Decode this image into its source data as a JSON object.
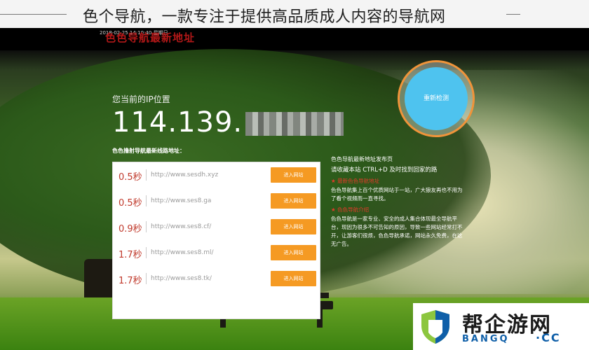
{
  "caption": {
    "text": "色个导航，一款专注于提供高品质成人内容的导航网"
  },
  "header": {
    "date": "2018-02-25 14:10:40 星期日",
    "title": "色色导航最新地址"
  },
  "ip": {
    "label": "您当前的IP位置",
    "value_visible": "114.139."
  },
  "links": {
    "label": "色色撸射导航最新线路地址：",
    "rows": [
      {
        "speed": "0.5秒",
        "url": "http://www.sesdh.xyz",
        "button": "进入网站"
      },
      {
        "speed": "0.5秒",
        "url": "http://www.ses8.ga",
        "button": "进入网站"
      },
      {
        "speed": "0.9秒",
        "url": "http://www.ses8.cf/",
        "button": "进入网站"
      },
      {
        "speed": "1.7秒",
        "url": "http://www.ses8.ml/",
        "button": "进入网站"
      },
      {
        "speed": "1.7秒",
        "url": "http://www.ses8.tk/",
        "button": "进入网站"
      }
    ]
  },
  "recheck": {
    "label": "重新检测"
  },
  "info": {
    "heading": "色色导航最新地址发布页",
    "tip": "请收藏本站 CTRL+D 及时找到回家的路",
    "section1_title": "★ 最新色色导航地址",
    "section1_text": "色色导航集上百个优质网站于一站，广大狼友再也不用为了看个视频而一直寻找。",
    "section2_title": "★ 色色导航介绍",
    "section2_text": "色色导航是一家专业、安全的成人集合体现最全导航平台，现因为很多不可告知的原因，导致一些网站经常打不开，让游客们很烦，色色导航承诺，网站永久免费，在这无广告。"
  },
  "watermark": {
    "cn": "帮企游网",
    "en": "BANGQ",
    "cc": "·CC"
  },
  "colors": {
    "button": "#f59a23",
    "speed": "#c0392b",
    "recheck": "#4ec3ef",
    "ring": "#f0943a",
    "title": "#b31818"
  }
}
